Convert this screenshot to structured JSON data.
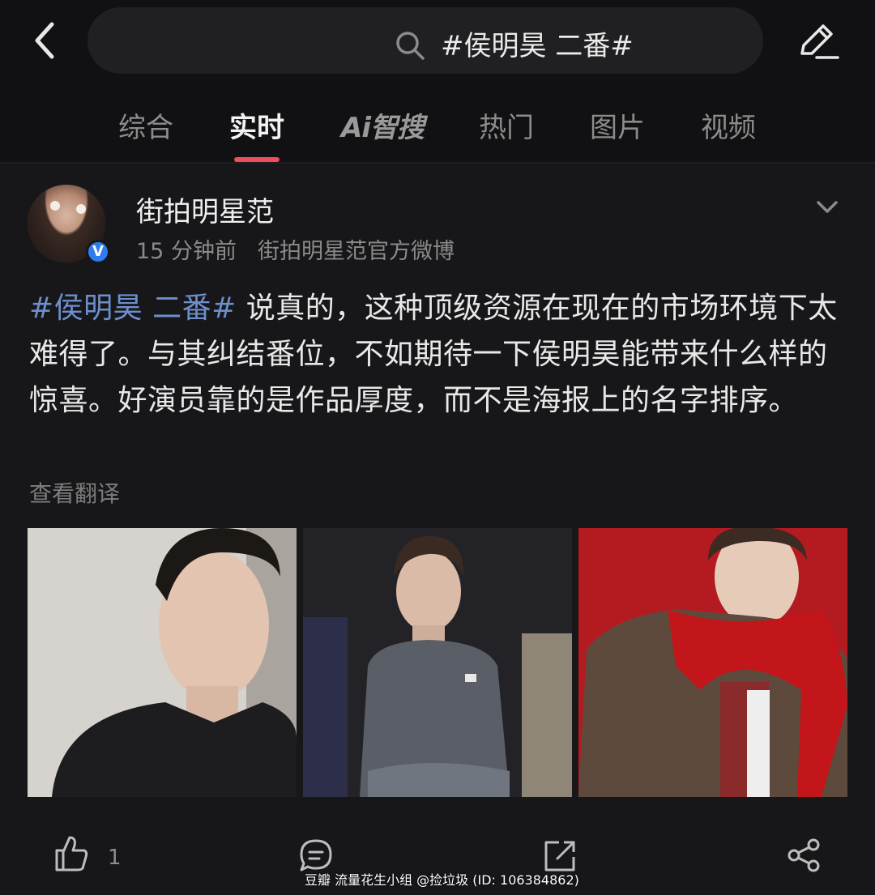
{
  "search": {
    "query": "#侯明昊 二番#"
  },
  "tabs": [
    {
      "label": "综合",
      "active": false
    },
    {
      "label": "实时",
      "active": true
    },
    {
      "label": "Ai智搜",
      "active": false
    },
    {
      "label": "热门",
      "active": false
    },
    {
      "label": "图片",
      "active": false
    },
    {
      "label": "视频",
      "active": false
    }
  ],
  "post": {
    "username": "街拍明星范",
    "time": "15 分钟前",
    "source": "街拍明星范官方微博",
    "verified_badge": "V",
    "hashtag": "#侯明昊 二番#",
    "text": " 说真的，这种顶级资源在现在的市场环境下太难得了。与其纠结番位，不如期待一下侯明昊能带来什么样的惊喜。好演员靠的是作品厚度，而不是海报上的名字排序。",
    "translate_label": "查看翻译",
    "like_count": "1"
  },
  "watermark": "豆瓣  流量花生小组 @捡垃圾 (ID: 106384862)",
  "colors": {
    "background": "#111113",
    "card": "#17171a",
    "accent": "#f04c5c",
    "hashtag": "#6d8fcc",
    "verified": "#2f7bf0"
  },
  "icons": [
    "back-arrow-icon",
    "search-icon",
    "edit-icon",
    "chevron-down-icon",
    "like-icon",
    "comment-icon",
    "repost-icon",
    "share-icon"
  ]
}
